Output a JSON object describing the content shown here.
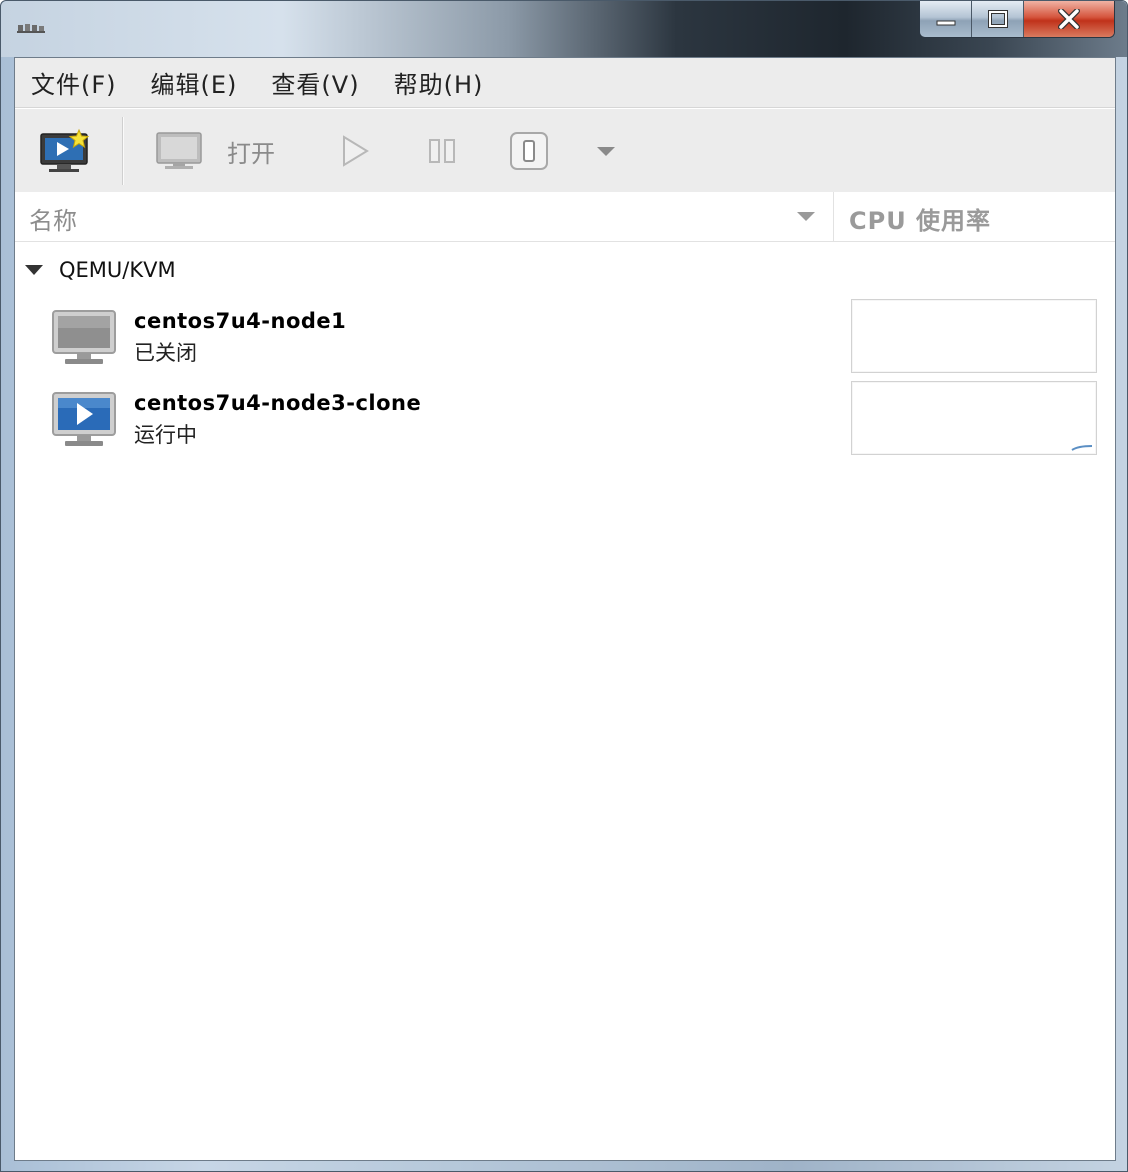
{
  "window": {
    "title": "",
    "controls": {
      "minimize_icon": "minimize-icon",
      "maximize_icon": "maximize-icon",
      "close_icon": "close-icon"
    }
  },
  "menu": {
    "items": [
      {
        "label": "文件(F)"
      },
      {
        "label": "编辑(E)"
      },
      {
        "label": "查看(V)"
      },
      {
        "label": "帮助(H)"
      }
    ]
  },
  "toolbar": {
    "new_vm_icon": "new-vm-icon",
    "open_icon": "monitor-icon",
    "open_label": "打开",
    "run_icon": "play-icon",
    "pause_icon": "pause-icon",
    "shutdown_icon": "power-icon",
    "shutdown_menu_icon": "chevron-down-icon"
  },
  "columns": {
    "name": "名称",
    "cpu": "CPU 使用率"
  },
  "connections": [
    {
      "label": "QEMU/KVM",
      "vms": [
        {
          "name": "centos7u4-node1",
          "state": "已关闭",
          "running": false,
          "cpu_usage": 0
        },
        {
          "name": "centos7u4-node3-clone",
          "state": "运行中",
          "running": true,
          "cpu_usage": 0.02
        }
      ]
    }
  ],
  "colors": {
    "running_screen": "#2a6bb8",
    "cpu_line": "#5b8fc4"
  }
}
